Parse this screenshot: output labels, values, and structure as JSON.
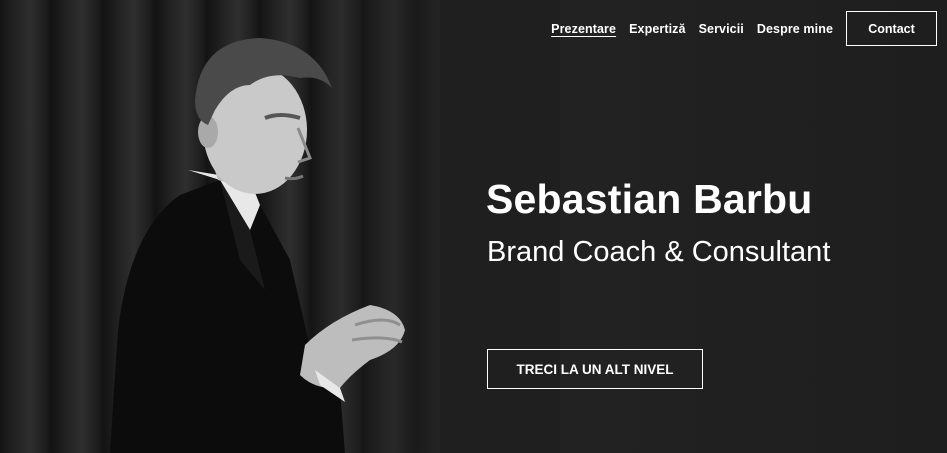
{
  "nav": {
    "items": [
      {
        "label": "Prezentare",
        "active": true
      },
      {
        "label": "Expertiză",
        "active": false
      },
      {
        "label": "Servicii",
        "active": false
      },
      {
        "label": "Despre mine",
        "active": false
      }
    ],
    "contact_label": "Contact"
  },
  "hero": {
    "name": "Sebastian Barbu",
    "tagline": "Brand Coach & Consultant",
    "cta_label": "TRECI LA UN ALT NIVEL"
  },
  "colors": {
    "background": "#1c1c1c",
    "text": "#ffffff"
  }
}
